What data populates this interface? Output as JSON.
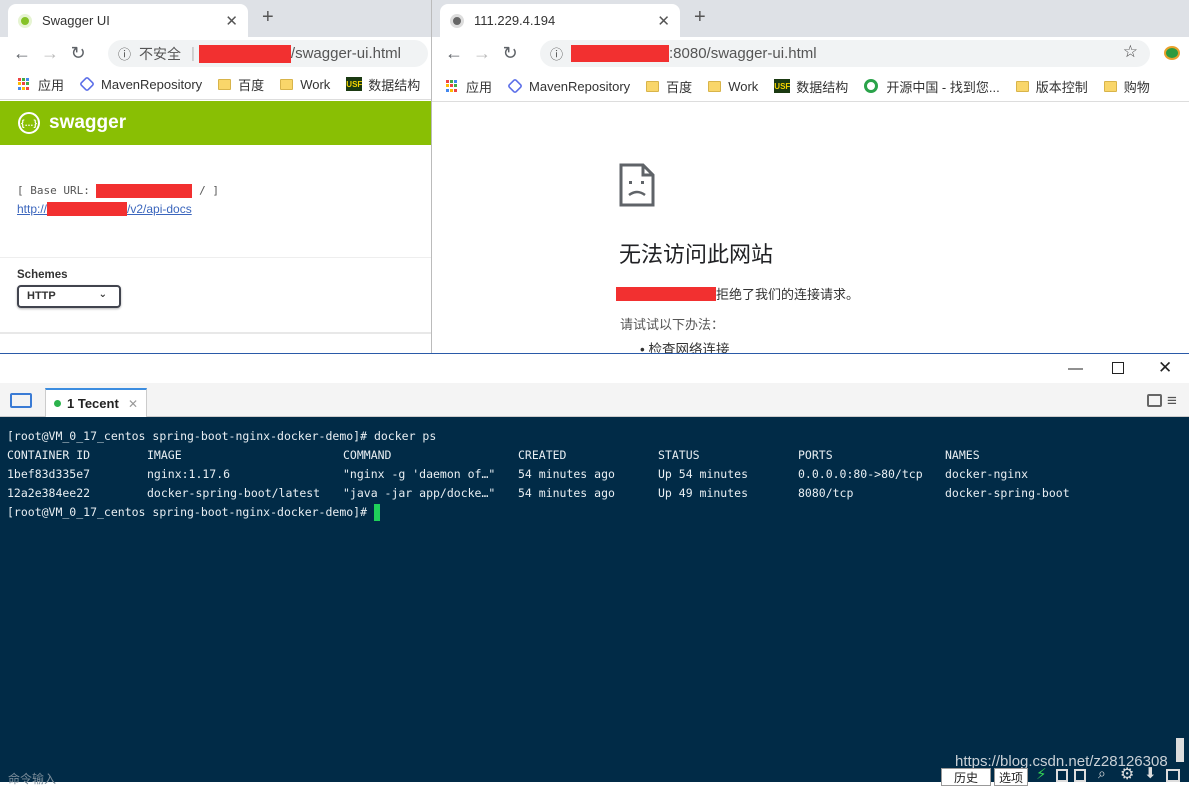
{
  "left_browser": {
    "tab_title": "Swagger UI",
    "url_prefix": "不安全",
    "url_suffix": "/swagger-ui.html",
    "bookmarks": [
      "应用",
      "MavenRepository",
      "百度",
      "Work",
      "数据结构"
    ],
    "swagger": {
      "logo": "swagger",
      "base_url_label": "[ Base URL:",
      "base_url_end": "/ ]",
      "api_docs_prefix": "http://",
      "api_docs_suffix": "/v2/api-docs",
      "schemes_label": "Schemes",
      "scheme_value": "HTTP"
    }
  },
  "right_browser": {
    "tab_title": "111.229.4.194",
    "url_suffix": ":8080/swagger-ui.html",
    "bookmarks": [
      "应用",
      "MavenRepository",
      "百度",
      "Work",
      "数据结构",
      "开源中国 - 找到您...",
      "版本控制",
      "购物"
    ],
    "error": {
      "heading": "无法访问此网站",
      "refused_text": "拒绝了我们的连接请求。",
      "try_label": "请试试以下办法：",
      "suggestion": "检查网络连接"
    }
  },
  "terminal": {
    "tab_label": "1 Tecent",
    "prompt": "[root@VM_0_17_centos spring-boot-nginx-docker-demo]#",
    "command": " docker ps",
    "headers": [
      "CONTAINER ID",
      "IMAGE",
      "COMMAND",
      "CREATED",
      "STATUS",
      "PORTS",
      "NAMES"
    ],
    "rows": [
      [
        "1bef83d335e7",
        "nginx:1.17.6",
        "\"nginx -g 'daemon of…\"",
        "54 minutes ago",
        "Up 54 minutes",
        "0.0.0.0:80->80/tcp",
        "docker-nginx"
      ],
      [
        "12a2e384ee22",
        "docker-spring-boot/latest",
        "\"java -jar app/docke…\"",
        "54 minutes ago",
        "Up 49 minutes",
        "8080/tcp",
        "docker-spring-boot"
      ]
    ],
    "prompt_end": "[root@VM_0_17_centos spring-boot-nginx-docker-demo]#",
    "input_label": "命令输入",
    "history_button": "历史",
    "options_button": "选项",
    "watermark": "https://blog.csdn.net/z28126308"
  }
}
